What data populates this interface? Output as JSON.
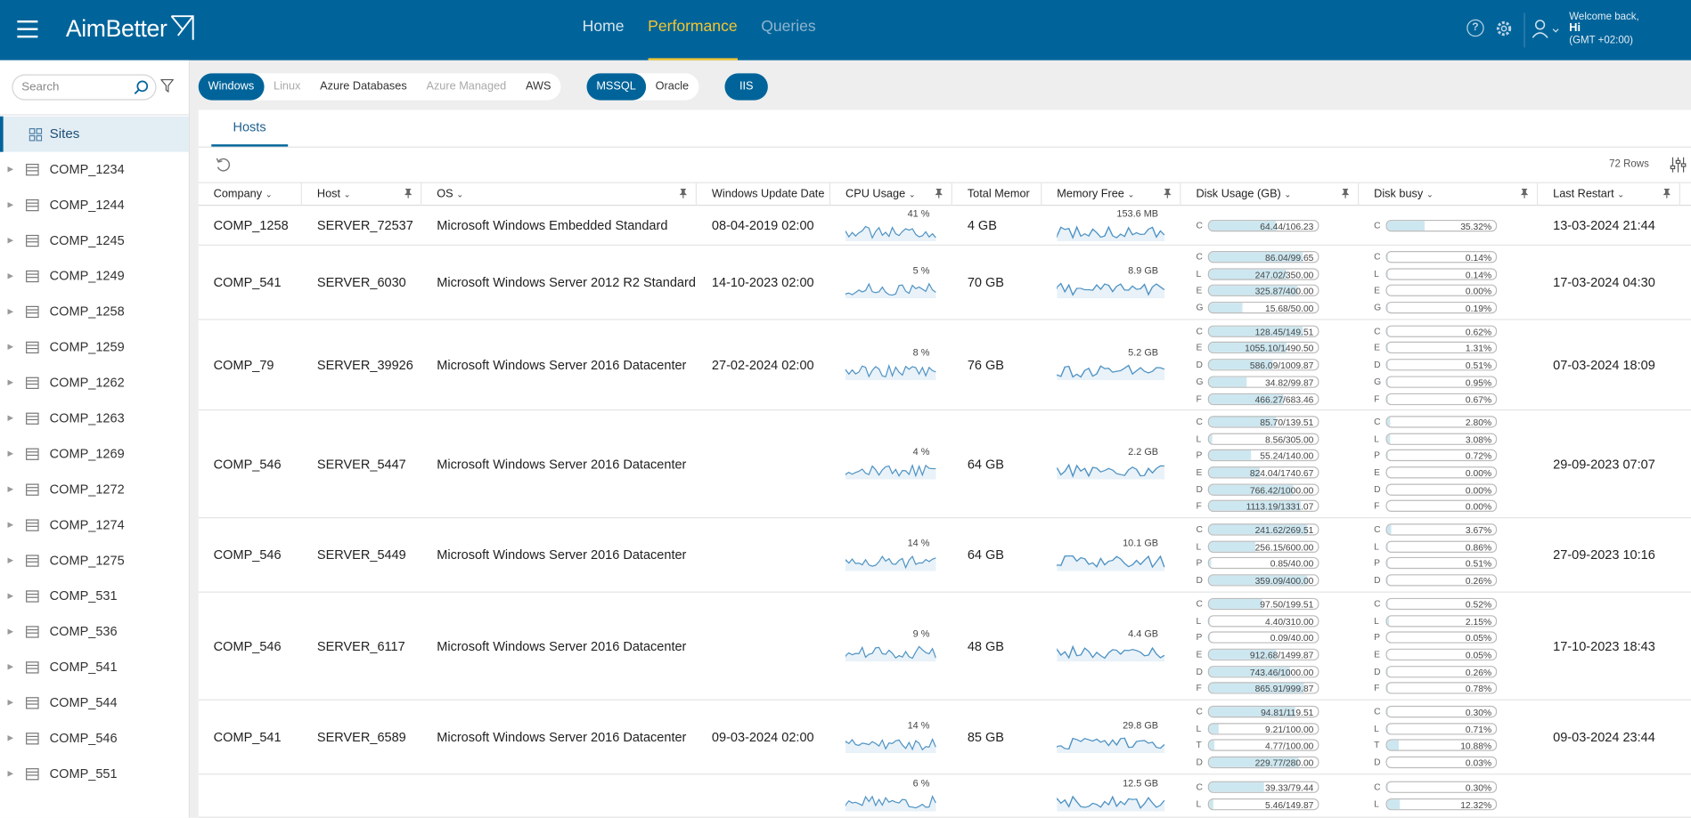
{
  "app": {
    "logo": "AimBetter",
    "welcome": "Welcome back,",
    "user": "Hi",
    "tz": "(GMT +02:00)"
  },
  "nav": [
    "Home",
    "Performance",
    "Queries"
  ],
  "sidebar": {
    "search_placeholder": "Search",
    "sites_label": "Sites",
    "items": [
      "COMP_1234",
      "COMP_1244",
      "COMP_1245",
      "COMP_1249",
      "COMP_1258",
      "COMP_1259",
      "COMP_1262",
      "COMP_1263",
      "COMP_1269",
      "COMP_1272",
      "COMP_1274",
      "COMP_1275",
      "COMP_531",
      "COMP_536",
      "COMP_541",
      "COMP_544",
      "COMP_546",
      "COMP_551"
    ]
  },
  "filters": {
    "platforms": [
      {
        "label": "Windows",
        "state": "on"
      },
      {
        "label": "Linux",
        "state": "off"
      },
      {
        "label": "Azure Databases",
        "state": "normal"
      },
      {
        "label": "Azure Managed",
        "state": "off"
      },
      {
        "label": "AWS",
        "state": "normal"
      }
    ],
    "engines": [
      {
        "label": "MSSQL",
        "state": "on"
      },
      {
        "label": "Oracle",
        "state": "normal"
      }
    ],
    "other": [
      {
        "label": "IIS",
        "state": "on"
      }
    ]
  },
  "tab": "Hosts",
  "rows_label": "72 Rows",
  "columns": [
    "Company",
    "Host",
    "OS",
    "Windows Update Date",
    "CPU Usage",
    "Total Memor",
    "Memory Free",
    "Disk Usage (GB)",
    "Disk busy",
    "Last Restart"
  ],
  "rows": [
    {
      "company": "COMP_1258",
      "host": "SERVER_72537",
      "os": "Microsoft Windows Embedded Standard",
      "update": "08-04-2019 02:00",
      "cpu": "41 %",
      "mem": "4 GB",
      "free": "153.6 MB",
      "restart": "13-03-2024 21:44",
      "disks": [
        {
          "l": "C",
          "v": "64.44/106.23",
          "p": 0.61
        }
      ],
      "busy": [
        {
          "l": "C",
          "v": "35.32%",
          "p": 0.35
        }
      ]
    },
    {
      "company": "COMP_541",
      "host": "SERVER_6030",
      "os": "Microsoft Windows Server 2012 R2 Standard",
      "update": "14-10-2023 02:00",
      "cpu": "5 %",
      "mem": "70 GB",
      "free": "8.9 GB",
      "restart": "17-03-2024 04:30",
      "disks": [
        {
          "l": "C",
          "v": "86.04/99.65",
          "p": 0.86
        },
        {
          "l": "L",
          "v": "247.02/350.00",
          "p": 0.71
        },
        {
          "l": "E",
          "v": "325.87/400.00",
          "p": 0.81
        },
        {
          "l": "G",
          "v": "15.68/50.00",
          "p": 0.31
        }
      ],
      "busy": [
        {
          "l": "C",
          "v": "0.14%",
          "p": 0.01
        },
        {
          "l": "L",
          "v": "0.14%",
          "p": 0.01
        },
        {
          "l": "E",
          "v": "0.00%",
          "p": 0
        },
        {
          "l": "G",
          "v": "0.19%",
          "p": 0.01
        }
      ]
    },
    {
      "company": "COMP_79",
      "host": "SERVER_39926",
      "os": "Microsoft Windows Server 2016 Datacenter",
      "update": "27-02-2024 02:00",
      "cpu": "8 %",
      "mem": "76 GB",
      "free": "5.2 GB",
      "restart": "07-03-2024 18:09",
      "disks": [
        {
          "l": "C",
          "v": "128.45/149.51",
          "p": 0.86
        },
        {
          "l": "E",
          "v": "1055.10/1490.50",
          "p": 0.71
        },
        {
          "l": "D",
          "v": "586.09/1009.87",
          "p": 0.58
        },
        {
          "l": "G",
          "v": "34.82/99.87",
          "p": 0.35
        },
        {
          "l": "F",
          "v": "466.27/683.46",
          "p": 0.68
        }
      ],
      "busy": [
        {
          "l": "C",
          "v": "0.62%",
          "p": 0.01
        },
        {
          "l": "E",
          "v": "1.31%",
          "p": 0.01
        },
        {
          "l": "D",
          "v": "0.51%",
          "p": 0.01
        },
        {
          "l": "G",
          "v": "0.95%",
          "p": 0.01
        },
        {
          "l": "F",
          "v": "0.67%",
          "p": 0.01
        }
      ]
    },
    {
      "company": "COMP_546",
      "host": "SERVER_5447",
      "os": "Microsoft Windows Server 2016 Datacenter",
      "update": "",
      "cpu": "4 %",
      "mem": "64 GB",
      "free": "2.2 GB",
      "restart": "29-09-2023 07:07",
      "disks": [
        {
          "l": "C",
          "v": "85.70/139.51",
          "p": 0.61
        },
        {
          "l": "L",
          "v": "8.56/305.00",
          "p": 0.03
        },
        {
          "l": "P",
          "v": "55.24/140.00",
          "p": 0.39
        },
        {
          "l": "E",
          "v": "824.04/1740.67",
          "p": 0.47
        },
        {
          "l": "D",
          "v": "766.42/1000.00",
          "p": 0.77
        },
        {
          "l": "F",
          "v": "1113.19/1331.07",
          "p": 0.84
        }
      ],
      "busy": [
        {
          "l": "C",
          "v": "2.80%",
          "p": 0.03
        },
        {
          "l": "L",
          "v": "3.08%",
          "p": 0.03
        },
        {
          "l": "P",
          "v": "0.72%",
          "p": 0.01
        },
        {
          "l": "E",
          "v": "0.00%",
          "p": 0
        },
        {
          "l": "D",
          "v": "0.00%",
          "p": 0
        },
        {
          "l": "F",
          "v": "0.00%",
          "p": 0
        }
      ]
    },
    {
      "company": "COMP_546",
      "host": "SERVER_5449",
      "os": "Microsoft Windows Server 2016 Datacenter",
      "update": "",
      "cpu": "14 %",
      "mem": "64 GB",
      "free": "10.1 GB",
      "restart": "27-09-2023 10:16",
      "disks": [
        {
          "l": "C",
          "v": "241.62/269.51",
          "p": 0.9
        },
        {
          "l": "L",
          "v": "256.15/600.00",
          "p": 0.43
        },
        {
          "l": "P",
          "v": "0.85/40.00",
          "p": 0.02
        },
        {
          "l": "D",
          "v": "359.09/400.00",
          "p": 0.9
        }
      ],
      "busy": [
        {
          "l": "C",
          "v": "3.67%",
          "p": 0.04
        },
        {
          "l": "L",
          "v": "0.86%",
          "p": 0.01
        },
        {
          "l": "P",
          "v": "0.51%",
          "p": 0.01
        },
        {
          "l": "D",
          "v": "0.26%",
          "p": 0.01
        }
      ]
    },
    {
      "company": "COMP_546",
      "host": "SERVER_6117",
      "os": "Microsoft Windows Server 2016 Datacenter",
      "update": "",
      "cpu": "9 %",
      "mem": "48 GB",
      "free": "4.4 GB",
      "restart": "17-10-2023 18:43",
      "disks": [
        {
          "l": "C",
          "v": "97.50/199.51",
          "p": 0.49
        },
        {
          "l": "L",
          "v": "4.40/310.00",
          "p": 0.01
        },
        {
          "l": "P",
          "v": "0.09/40.00",
          "p": 0.01
        },
        {
          "l": "E",
          "v": "912.68/1499.87",
          "p": 0.61
        },
        {
          "l": "D",
          "v": "743.46/1000.00",
          "p": 0.74
        },
        {
          "l": "F",
          "v": "865.91/999.87",
          "p": 0.87
        }
      ],
      "busy": [
        {
          "l": "C",
          "v": "0.52%",
          "p": 0.01
        },
        {
          "l": "L",
          "v": "2.15%",
          "p": 0.02
        },
        {
          "l": "P",
          "v": "0.05%",
          "p": 0
        },
        {
          "l": "E",
          "v": "0.05%",
          "p": 0
        },
        {
          "l": "D",
          "v": "0.26%",
          "p": 0.01
        },
        {
          "l": "F",
          "v": "0.78%",
          "p": 0.01
        }
      ]
    },
    {
      "company": "COMP_541",
      "host": "SERVER_6589",
      "os": "Microsoft Windows Server 2016 Datacenter",
      "update": "09-03-2024 02:00",
      "cpu": "14 %",
      "mem": "85 GB",
      "free": "29.8 GB",
      "restart": "09-03-2024 23:44",
      "disks": [
        {
          "l": "C",
          "v": "94.81/119.51",
          "p": 0.79
        },
        {
          "l": "L",
          "v": "9.21/100.00",
          "p": 0.09
        },
        {
          "l": "T",
          "v": "4.77/100.00",
          "p": 0.05
        },
        {
          "l": "D",
          "v": "229.77/280.00",
          "p": 0.82
        }
      ],
      "busy": [
        {
          "l": "C",
          "v": "0.30%",
          "p": 0.01
        },
        {
          "l": "L",
          "v": "0.71%",
          "p": 0.01
        },
        {
          "l": "T",
          "v": "10.88%",
          "p": 0.11
        },
        {
          "l": "D",
          "v": "0.03%",
          "p": 0
        }
      ]
    },
    {
      "company": "",
      "host": "",
      "os": "",
      "update": "",
      "cpu": "6 %",
      "mem": "",
      "free": "12.5 GB",
      "restart": "",
      "disks": [
        {
          "l": "C",
          "v": "39.33/79.44",
          "p": 0.5
        },
        {
          "l": "L",
          "v": "5.46/149.87",
          "p": 0.04
        }
      ],
      "busy": [
        {
          "l": "C",
          "v": "0.30%",
          "p": 0.01
        },
        {
          "l": "L",
          "v": "12.32%",
          "p": 0.12
        }
      ]
    }
  ]
}
